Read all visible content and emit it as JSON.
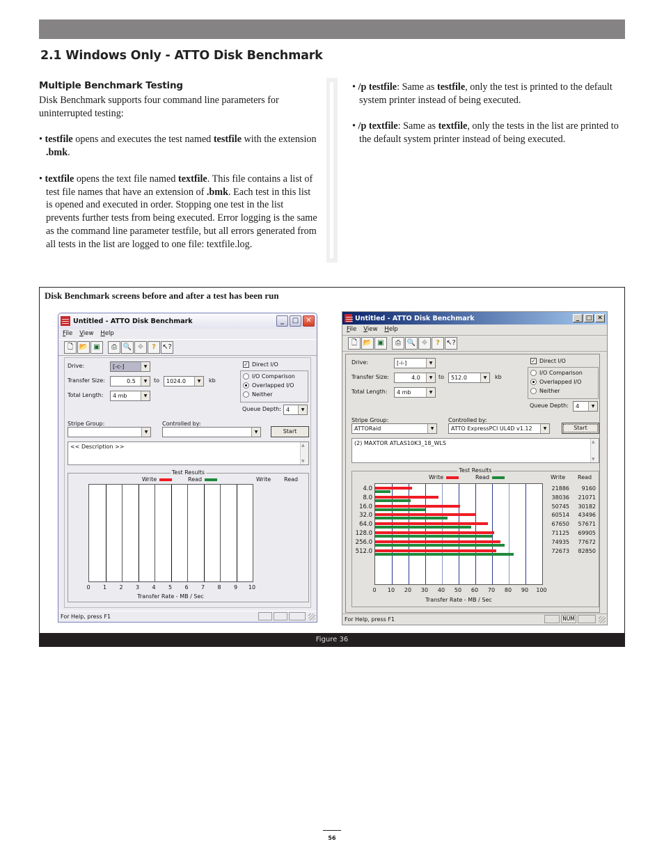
{
  "page": {
    "section_title": "2.1 Windows Only - ATTO Disk Benchmark",
    "subsection_title": "Multiple Benchmark Testing",
    "intro": "Disk Benchmark supports four command line parameters for uninterrupted testing:",
    "left_bullets": [
      {
        "term": "testfile",
        "rest_html_parts": [
          " opens and executes the test named ",
          "testfile",
          " with the extension ",
          ".bmk",
          "."
        ]
      },
      {
        "term": "textfile",
        "rest_html_parts": [
          " opens the text file named ",
          "textfile",
          ". This file contains a list of test file names that have an extension of ",
          ".bmk",
          ". Each test in this list is opened and executed in order. Stopping one test in the list prevents further tests from being executed. Error logging is the same as the command line parameter testfile, but all errors generated from all tests in the list are logged to one file: textfile.log."
        ]
      }
    ],
    "right_bullets": [
      {
        "term": "/p testfile",
        "rest_html_parts": [
          ": Same as ",
          "testfile",
          ", only the test is printed to the default system printer instead of being executed."
        ]
      },
      {
        "term": "/p textfile",
        "rest_html_parts": [
          ": Same as ",
          "textfile",
          ", only the tests in the list are printed to the default system printer instead of being executed."
        ]
      }
    ],
    "page_number": "56"
  },
  "figure": {
    "caption": "Disk Benchmark screens before and after a test has been run",
    "label": "Figure 36"
  },
  "window_before": {
    "title": "Untitled - ATTO Disk Benchmark",
    "menu": [
      "File",
      "View",
      "Help"
    ],
    "toolbar_icons": [
      "new-icon",
      "open-icon",
      "save-icon",
      "print-icon",
      "print-preview-icon",
      "move-icon",
      "help-icon",
      "context-help-icon"
    ],
    "labels": {
      "drive": "Drive:",
      "transfer_size": "Transfer Size:",
      "to": "to",
      "kb": "kb",
      "total_length": "Total Length:",
      "direct_io": "Direct I/O",
      "io_comparison": "I/O Comparison",
      "overlapped_io": "Overlapped I/O",
      "neither": "Neither",
      "queue_depth": "Queue Depth:",
      "stripe_group": "Stripe Group:",
      "controlled_by": "Controlled by:",
      "start": "Start",
      "test_results": "Test Results",
      "write": "Write",
      "read": "Read",
      "xlabel": "Transfer Rate - MB / Sec"
    },
    "values": {
      "drive": "[-c-]",
      "transfer_from": "0.5",
      "transfer_to": "1024.0",
      "total_length": "4 mb",
      "queue_depth": "4",
      "stripe_group": "",
      "controlled_by": "",
      "description": "<< Description >>"
    },
    "direct_io_checked": true,
    "io_mode": "Overlapped I/O",
    "status": "For Help, press F1"
  },
  "window_after": {
    "title": "Untitled - ATTO Disk Benchmark",
    "menu": [
      "File",
      "View",
      "Help"
    ],
    "labels": {
      "drive": "Drive:",
      "transfer_size": "Transfer Size:",
      "to": "to",
      "kb": "kb",
      "total_length": "Total Length:",
      "direct_io": "Direct I/O",
      "io_comparison": "I/O Comparison",
      "overlapped_io": "Overlapped I/O",
      "neither": "Neither",
      "queue_depth": "Queue Depth:",
      "stripe_group": "Stripe Group:",
      "controlled_by": "Controlled by:",
      "start": "Start",
      "test_results": "Test Results",
      "write": "Write",
      "read": "Read",
      "xlabel": "Transfer Rate - MB / Sec"
    },
    "values": {
      "drive": "[-i-]",
      "transfer_from": "4.0",
      "transfer_to": "512.0",
      "total_length": "4 mb",
      "queue_depth": "4",
      "stripe_group": "ATTORaid",
      "controlled_by": "ATTO ExpressPCI UL4D  v1.12",
      "description": "(2) MAXTOR ATLAS10K3_18_WLS"
    },
    "direct_io_checked": true,
    "io_mode": "Overlapped I/O",
    "status": "For Help, press F1",
    "status_num": "NUM"
  },
  "colors": {
    "write": "#ee1c25",
    "read": "#1f8a3b",
    "grid_dark": "#2a3590",
    "grid_light": "#8c95c8"
  },
  "chart_data": [
    {
      "type": "bar",
      "orientation": "horizontal",
      "title": "Test Results (before)",
      "xlabel": "Transfer Rate - MB / Sec",
      "xlim": [
        0,
        10
      ],
      "xticks": [
        "0",
        "1",
        "2",
        "3",
        "4",
        "5",
        "6",
        "7",
        "8",
        "9",
        "10"
      ],
      "legend": [
        "Write",
        "Read"
      ],
      "categories": [],
      "series": [
        {
          "name": "Write",
          "values": []
        },
        {
          "name": "Read",
          "values": []
        }
      ]
    },
    {
      "type": "bar",
      "orientation": "horizontal",
      "title": "Test Results (after)",
      "xlabel": "Transfer Rate - MB / Sec",
      "xlim": [
        0,
        100
      ],
      "xticks": [
        "0",
        "10",
        "20",
        "30",
        "40",
        "50",
        "60",
        "70",
        "80",
        "90",
        "100"
      ],
      "legend": [
        "Write",
        "Read"
      ],
      "categories": [
        "4.0",
        "8.0",
        "16.0",
        "32.0",
        "64.0",
        "128.0",
        "256.0",
        "512.0"
      ],
      "series": [
        {
          "name": "Write",
          "unit": "KB/s",
          "values": [
            21886,
            38036,
            50745,
            60514,
            67650,
            71125,
            74935,
            72673
          ]
        },
        {
          "name": "Read",
          "unit": "KB/s",
          "values": [
            9160,
            21071,
            30182,
            43496,
            57671,
            69905,
            77672,
            82850
          ]
        }
      ]
    }
  ]
}
